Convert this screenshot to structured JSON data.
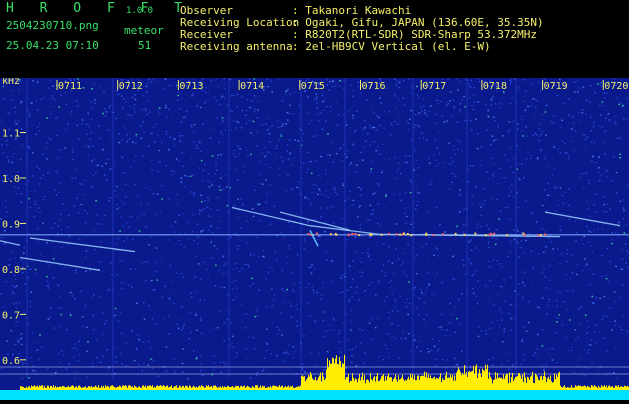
{
  "header": {
    "brand": "H R O F F T",
    "version": "1.0.0",
    "filename": "2504230710.png",
    "datetime": "25.04.23 07:10",
    "meteor_label": "meteor",
    "meteor_count": "51"
  },
  "info": {
    "observer_label": "Observer",
    "observer_value": ": Takanori Kawachi",
    "location_label": "Receiving Location",
    "location_value": ": Ogaki, Gifu, JAPAN (136.60E, 35.35N)",
    "receiver_label": "Receiver",
    "receiver_value": ": R820T2(RTL-SDR) SDR-Sharp 53.372MHz",
    "antenna_label": "Receiving antenna",
    "antenna_value": ": 2el-HB9CV Vertical (el. E-W)"
  },
  "chart_data": {
    "type": "heatmap",
    "ylabel": "kHz",
    "time_labels": [
      "0711",
      "0712",
      "0713",
      "0714",
      "0715",
      "0716",
      "0717",
      "0718",
      "0719",
      "0720"
    ],
    "y_ticks": [
      "1.1",
      "1.0",
      "0.9",
      "0.8",
      "0.7",
      "0.6"
    ],
    "ylim": [
      0.56,
      1.22
    ],
    "carrier_khz": 0.875,
    "colors": {
      "background": "#0a1a8c",
      "noise": "#3a5cff",
      "carrier": "#7fb0ff",
      "echo": "#9ad0ff",
      "echo_hot": "#ff6060",
      "level_bar": "#ffee00",
      "level_base": "#00e0ff",
      "tick_text": "#f4f06a"
    }
  }
}
